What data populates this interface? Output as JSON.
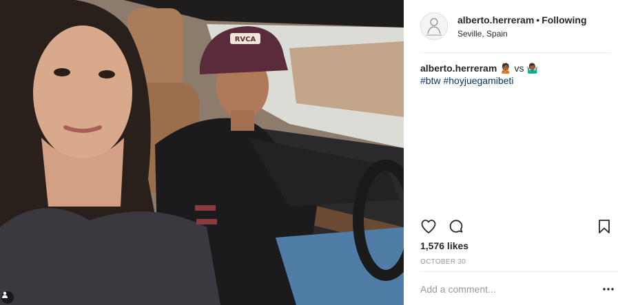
{
  "post": {
    "photo": {
      "description_icon": "tag-people-icon"
    },
    "header": {
      "username": "alberto.herreram",
      "separator": "•",
      "follow_status": "Following",
      "location": "Seville, Spain"
    },
    "caption": {
      "username": "alberto.herreram",
      "text": "🙎🏾 vs 🤷🏾‍♂️",
      "hashtags": [
        "#btw",
        "#hoyjuegamibeti"
      ]
    },
    "actions": {
      "like_icon": "heart-icon",
      "comment_icon": "comment-icon",
      "save_icon": "bookmark-icon"
    },
    "likes": "1,576 likes",
    "date": "OCTOBER 30",
    "comment_box": {
      "placeholder": "Add a comment...",
      "more_icon": "more-options-icon"
    }
  },
  "colors": {
    "text": "#262626",
    "hashtag": "#003569",
    "muted": "#999999",
    "divider": "#efefef"
  }
}
